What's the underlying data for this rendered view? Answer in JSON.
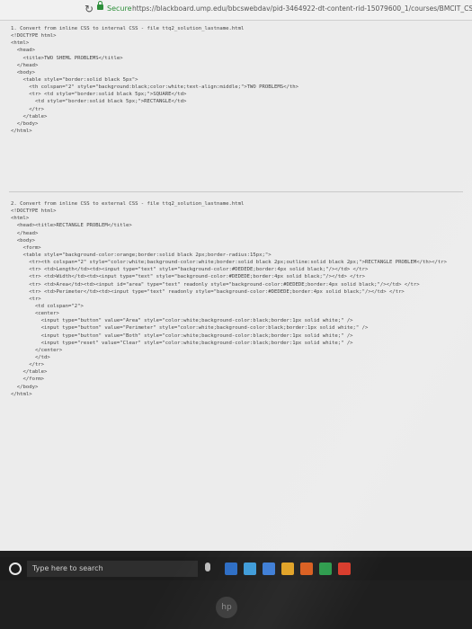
{
  "browser": {
    "secure_label": "Secure",
    "url": "https://blackboard.ump.edu/bbcswebdav/pid-3464922-dt-content-rid-15079600_1/courses/BMCIT_CS_385_1700_1182_10588_Test-Fall-Spring/chabke..."
  },
  "document": {
    "section1": [
      "1. Convert from inline CSS to internal CSS - file ttq2_solution_lastname.html",
      "<!DOCTYPE html>",
      "<html>",
      "  <head>",
      "    <title>TWO SHEML PROBLEMS</title>",
      "  </head>",
      "  <body>",
      "    <table style=\"border:solid black 5px\">",
      "      <th colspan=\"2\" style=\"background:black;color:white;text-align:middle;\">TWO PROBLEMS</th>",
      "      <tr> <td style=\"border:solid black 5px;\">SQUARE</td>",
      "        <td style=\"border:solid black 5px;\">RECTANGLE</td>",
      "      </tr>",
      "    </table>",
      "  </body>",
      "</html>"
    ],
    "section2": [
      "2. Convert from inline CSS to external CSS - file ttq2_solution_lastname.html",
      "<!DOCTYPE html>",
      "<html>",
      "  <head><title>RECTANGLE PROBLEM</title>",
      "  </head>",
      "  <body>",
      "    <form>",
      "    <table style=\"background-color:orange;border:solid black 2px;border-radius:15px;\">",
      "      <tr><th colspan=\"2\" style=\"color:white;background-color:white;border:solid black 2px;outline:solid black 2px;\">RECTANGLE PROBLEM</th></tr>",
      "      <tr> <td>Length</td><td><input type=\"text\" style=\"background-color:#DEDEDE;border:4px solid black;\"/></td> </tr>",
      "      <tr> <td>Width</td><td><input type=\"text\" style=\"background-color:#DEDEDE;border:4px solid black;\"/></td> </tr>",
      "      <tr> <td>Area</td><td><input id=\"area\" type=\"text\" readonly style=\"background-color:#DEDEDE;border:4px solid black;\"/></td> </tr>",
      "      <tr> <td>Perimeter</td><td><input type=\"text\" readonly style=\"background-color:#DEDEDE;border:4px solid black;\"/></td> </tr>",
      "      <tr>",
      "        <td colspan=\"2\">",
      "        <center>",
      "          <input type=\"button\" value=\"Area\" style=\"color:white;background-color:black;border:1px solid white;\" />",
      "          <input type=\"button\" value=\"Perimeter\" style=\"color:white;background-color:black;border:1px solid white;\" />",
      "          <input type=\"button\" value=\"Both\" style=\"color:white;background-color:black;border:1px solid white;\" />",
      "          <input type=\"reset\" value=\"Clear\" style=\"color:white;background-color:black;border:1px solid white;\" />",
      "        </center>",
      "        </td>",
      "      </tr>",
      "    </table>",
      "    </form>",
      "  </body>",
      "</html>"
    ]
  },
  "taskbar": {
    "search_placeholder": "Type here to search",
    "icon_colors": [
      "#2b6cc4",
      "#3c9ad8",
      "#3a7bd5",
      "#e0a020",
      "#d85a1a",
      "#2a9a4a",
      "#d83a2a"
    ]
  },
  "hp_logo": "hp"
}
